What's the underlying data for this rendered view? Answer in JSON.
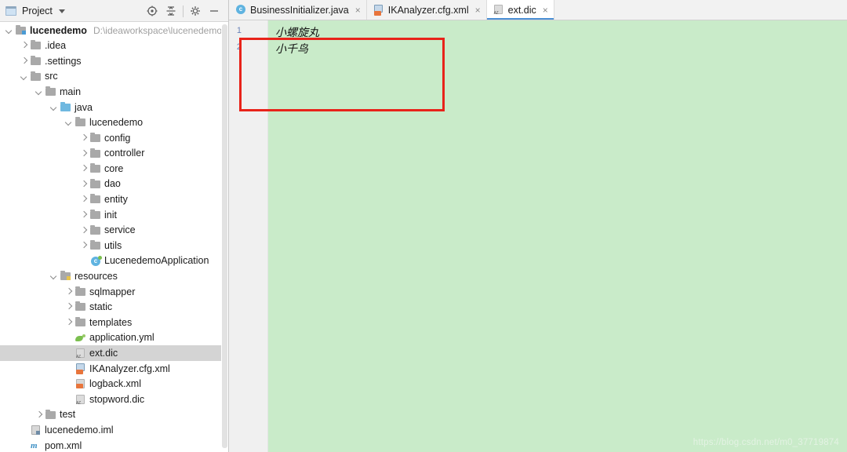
{
  "project_panel": {
    "title": "Project",
    "title_icon": "project-window-icon",
    "caret_icon": "chevron-down-icon",
    "tools": [
      {
        "name": "locate-icon",
        "glyph": "target"
      },
      {
        "name": "collapse-all-icon",
        "glyph": "collapse"
      },
      {
        "name": "gear-icon",
        "glyph": "gear"
      },
      {
        "name": "minimize-icon",
        "glyph": "minus"
      }
    ],
    "tree": [
      {
        "depth": 0,
        "arrow": "down",
        "icon": "module-folder",
        "label": "lucenedemo",
        "bold": true,
        "hint": "D:\\ideaworkspace\\lucenedemo",
        "selected": false
      },
      {
        "depth": 1,
        "arrow": "right",
        "icon": "folder",
        "label": ".idea",
        "bold": false,
        "hint": "",
        "selected": false
      },
      {
        "depth": 1,
        "arrow": "right",
        "icon": "folder",
        "label": ".settings",
        "bold": false,
        "hint": "",
        "selected": false
      },
      {
        "depth": 1,
        "arrow": "down",
        "icon": "folder",
        "label": "src",
        "bold": false,
        "hint": "",
        "selected": false
      },
      {
        "depth": 2,
        "arrow": "down",
        "icon": "folder",
        "label": "main",
        "bold": false,
        "hint": "",
        "selected": false
      },
      {
        "depth": 3,
        "arrow": "down",
        "icon": "source-folder",
        "label": "java",
        "bold": false,
        "hint": "",
        "selected": false
      },
      {
        "depth": 4,
        "arrow": "down",
        "icon": "package-folder",
        "label": "lucenedemo",
        "bold": false,
        "hint": "",
        "selected": false
      },
      {
        "depth": 5,
        "arrow": "right",
        "icon": "package-folder",
        "label": "config",
        "bold": false,
        "hint": "",
        "selected": false
      },
      {
        "depth": 5,
        "arrow": "right",
        "icon": "package-folder",
        "label": "controller",
        "bold": false,
        "hint": "",
        "selected": false
      },
      {
        "depth": 5,
        "arrow": "right",
        "icon": "package-folder",
        "label": "core",
        "bold": false,
        "hint": "",
        "selected": false
      },
      {
        "depth": 5,
        "arrow": "right",
        "icon": "package-folder",
        "label": "dao",
        "bold": false,
        "hint": "",
        "selected": false
      },
      {
        "depth": 5,
        "arrow": "right",
        "icon": "package-folder",
        "label": "entity",
        "bold": false,
        "hint": "",
        "selected": false
      },
      {
        "depth": 5,
        "arrow": "right",
        "icon": "package-folder",
        "label": "init",
        "bold": false,
        "hint": "",
        "selected": false
      },
      {
        "depth": 5,
        "arrow": "right",
        "icon": "package-folder",
        "label": "service",
        "bold": false,
        "hint": "",
        "selected": false
      },
      {
        "depth": 5,
        "arrow": "right",
        "icon": "package-folder",
        "label": "utils",
        "bold": false,
        "hint": "",
        "selected": false
      },
      {
        "depth": 5,
        "arrow": "none",
        "icon": "spring-class",
        "label": "LucenedemoApplication",
        "bold": false,
        "hint": "",
        "selected": false
      },
      {
        "depth": 3,
        "arrow": "down",
        "icon": "resources-folder",
        "label": "resources",
        "bold": false,
        "hint": "",
        "selected": false
      },
      {
        "depth": 4,
        "arrow": "right",
        "icon": "package-folder",
        "label": "sqlmapper",
        "bold": false,
        "hint": "",
        "selected": false
      },
      {
        "depth": 4,
        "arrow": "right",
        "icon": "package-folder",
        "label": "static",
        "bold": false,
        "hint": "",
        "selected": false
      },
      {
        "depth": 4,
        "arrow": "right",
        "icon": "package-folder",
        "label": "templates",
        "bold": false,
        "hint": "",
        "selected": false
      },
      {
        "depth": 4,
        "arrow": "none",
        "icon": "yml-file",
        "label": "application.yml",
        "bold": false,
        "hint": "",
        "selected": false
      },
      {
        "depth": 4,
        "arrow": "none",
        "icon": "dic-file",
        "label": "ext.dic",
        "bold": false,
        "hint": "",
        "selected": true
      },
      {
        "depth": 4,
        "arrow": "none",
        "icon": "xml-cfg-file",
        "label": "IKAnalyzer.cfg.xml",
        "bold": false,
        "hint": "",
        "selected": false
      },
      {
        "depth": 4,
        "arrow": "none",
        "icon": "xml-file",
        "label": "logback.xml",
        "bold": false,
        "hint": "",
        "selected": false
      },
      {
        "depth": 4,
        "arrow": "none",
        "icon": "dic-file",
        "label": "stopword.dic",
        "bold": false,
        "hint": "",
        "selected": false
      },
      {
        "depth": 2,
        "arrow": "right",
        "icon": "folder",
        "label": "test",
        "bold": false,
        "hint": "",
        "selected": false
      },
      {
        "depth": 1,
        "arrow": "none",
        "icon": "iml-file",
        "label": "lucenedemo.iml",
        "bold": false,
        "hint": "",
        "selected": false
      },
      {
        "depth": 1,
        "arrow": "none",
        "icon": "maven-file",
        "label": "pom.xml",
        "bold": false,
        "hint": "",
        "selected": false
      }
    ]
  },
  "editor": {
    "tabs": [
      {
        "label": "BusinessInitializer.java",
        "icon": "java-class-icon",
        "active": false,
        "close": "×"
      },
      {
        "label": "IKAnalyzer.cfg.xml",
        "icon": "xml-config-icon",
        "active": false,
        "close": "×"
      },
      {
        "label": "ext.dic",
        "icon": "dic-file-icon",
        "active": true,
        "close": "×"
      }
    ],
    "line_numbers": [
      "1",
      "2"
    ],
    "lines": [
      "小螺旋丸",
      "小千鸟"
    ],
    "background_color": "#c9ebc9",
    "gutter_color": "#f0f0f0",
    "annotation_color": "#e8231a",
    "active_tab_underline_color": "#4a8fd4"
  },
  "watermark": {
    "text": "https://blog.csdn.net/m0_37719874"
  }
}
